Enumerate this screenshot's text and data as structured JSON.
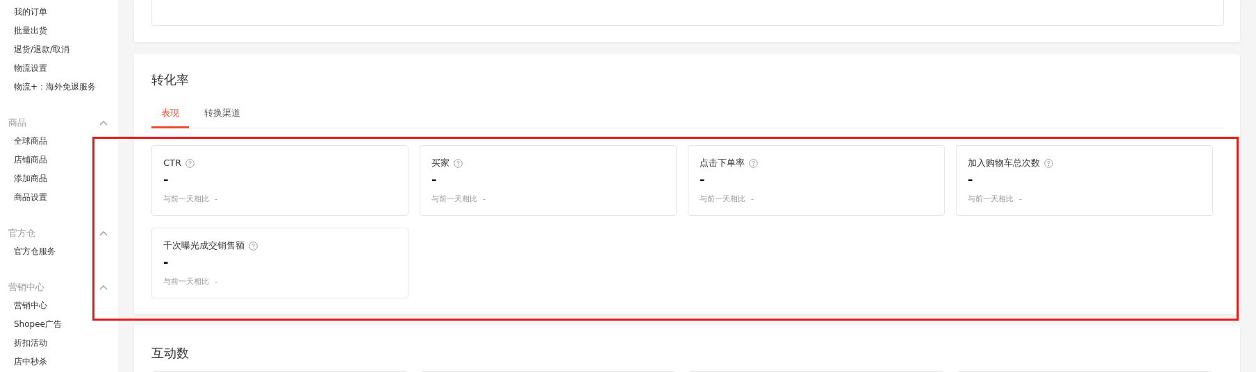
{
  "sidebar": {
    "groups": [
      {
        "items": [
          "我的订单",
          "批量出货",
          "退货/退款/取消",
          "物流设置",
          "物流+：海外免退服务"
        ]
      },
      {
        "title": "商品",
        "expanded": true,
        "items": [
          "全球商品",
          "店铺商品",
          "添加商品",
          "商品设置"
        ]
      },
      {
        "title": "官方仓",
        "expanded": true,
        "items": [
          "官方仓服务"
        ]
      },
      {
        "title": "营销中心",
        "expanded": true,
        "items": [
          "营销中心",
          "Shopee广告",
          "折扣活动",
          "店中秒杀"
        ]
      }
    ]
  },
  "conversion": {
    "title": "转化率",
    "tabs": [
      {
        "label": "表现",
        "selected": true
      },
      {
        "label": "转换渠道",
        "selected": false
      }
    ],
    "metrics": [
      {
        "label": "CTR",
        "value": "-",
        "compare_label": "与前一天相比",
        "compare_value": "-"
      },
      {
        "label": "买家",
        "value": "-",
        "compare_label": "与前一天相比",
        "compare_value": "-"
      },
      {
        "label": "点击下单率",
        "value": "-",
        "compare_label": "与前一天相比",
        "compare_value": "-"
      },
      {
        "label": "加入购物车总次数",
        "value": "-",
        "compare_label": "与前一天相比",
        "compare_value": "-"
      },
      {
        "label": "千次曝光成交销售额",
        "value": "-",
        "compare_label": "与前一天相比",
        "compare_value": "-"
      }
    ]
  },
  "interaction": {
    "title": "互动数"
  }
}
